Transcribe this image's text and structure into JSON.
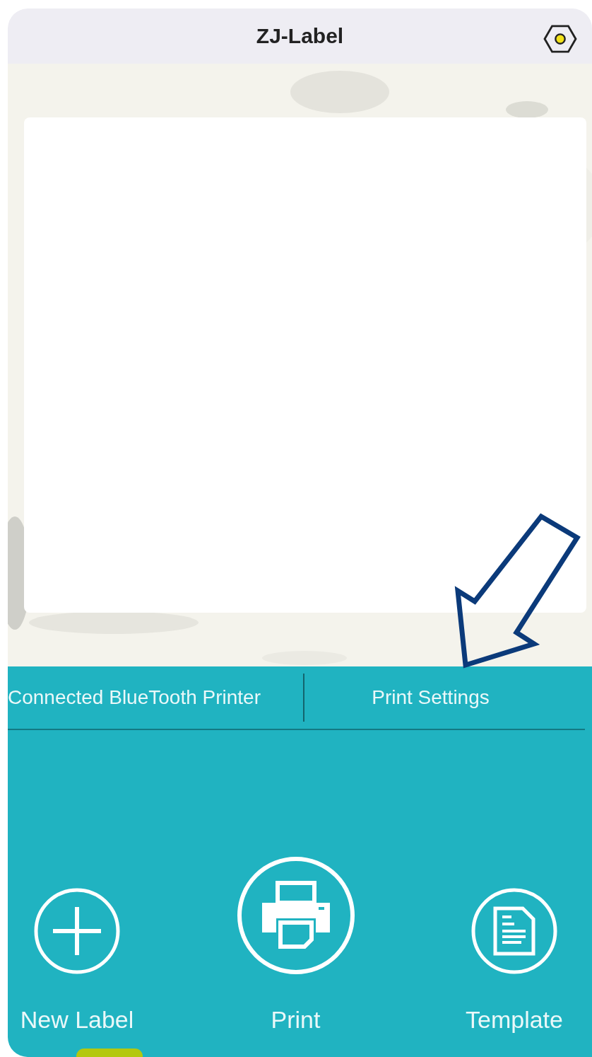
{
  "header": {
    "title": "ZJ-Label"
  },
  "links": [
    {
      "kind": "printer",
      "label": "Connected BlueTooth Printer"
    },
    {
      "kind": "settings",
      "label": "Print Settings"
    }
  ],
  "actions": [
    {
      "kind": "plus",
      "label": "New Label"
    },
    {
      "kind": "printer",
      "label": "Print"
    },
    {
      "kind": "document",
      "label": "Template"
    }
  ]
}
